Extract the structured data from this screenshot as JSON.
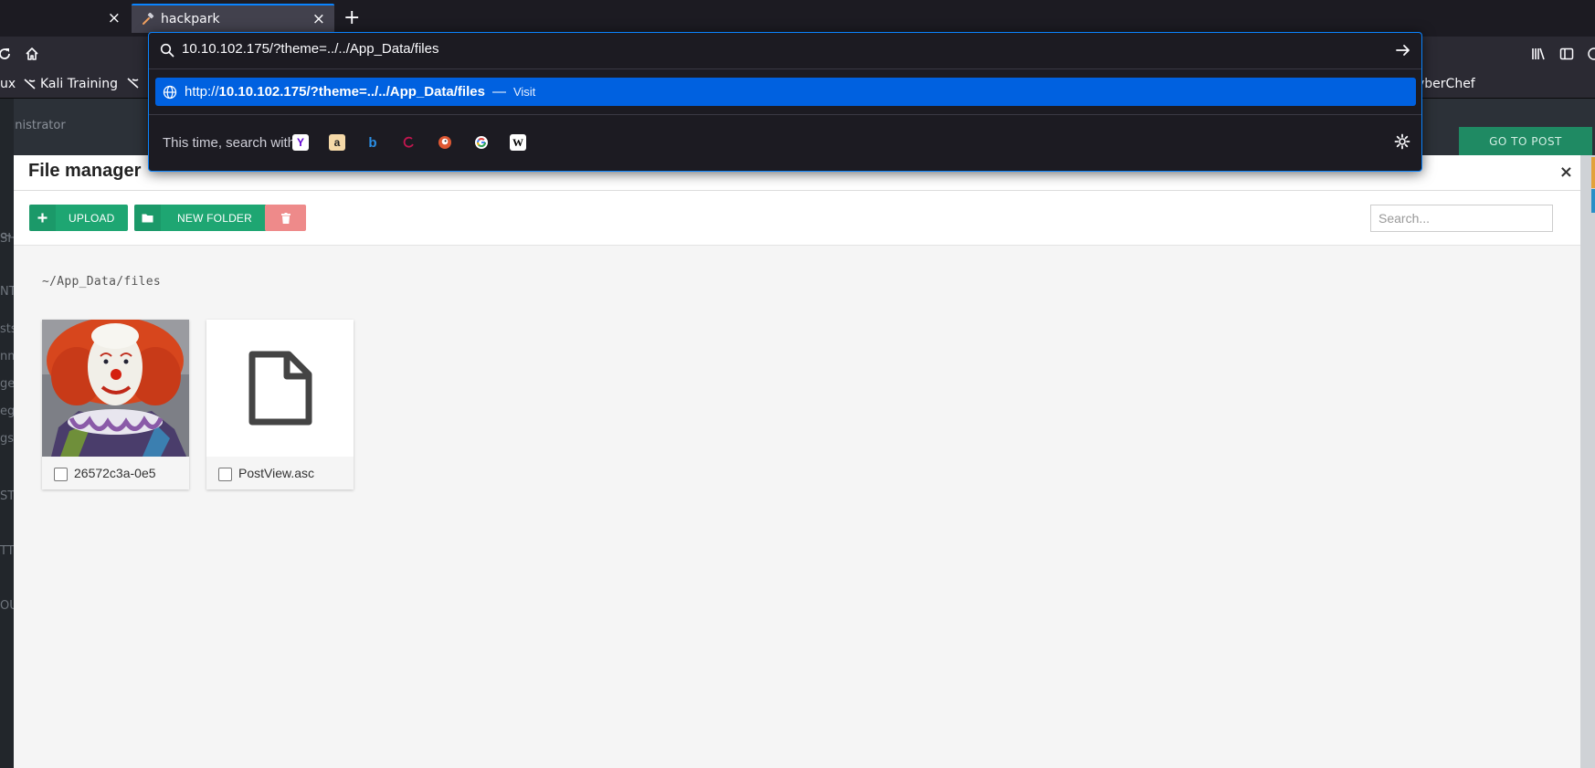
{
  "browser": {
    "tabs": [
      {
        "title": "",
        "active": false
      },
      {
        "title": "hackpark",
        "active": true
      }
    ],
    "close_glyph": "×",
    "new_tab_glyph": "+",
    "url": "10.10.102.175/?theme=../../App_Data/files",
    "bookmarks": {
      "left_fragment": "ux",
      "kali_training": "Kali Training",
      "right_fragment": "yberChef"
    },
    "suggestion": {
      "protocol": "http://",
      "host_path": "10.10.102.175/?theme=../../App_Data/files",
      "separator": "—",
      "action": "Visit"
    },
    "one_off_label": "This time, search with:",
    "search_engines": [
      "yahoo-icon",
      "amazon-icon",
      "bing-icon",
      "debian-icon",
      "duckduckgo-icon",
      "google-icon",
      "wikipedia-icon"
    ]
  },
  "page": {
    "admin_text": "ministrator",
    "goto_post": "GO TO POST",
    "sidebar_fragments": [
      "SH",
      "NT",
      "sts",
      "nm",
      "ges",
      "eg",
      "gs",
      "ST",
      "TT",
      "OU"
    ]
  },
  "file_manager": {
    "title": "File manager",
    "close": "×",
    "upload_label": "UPLOAD",
    "new_folder_label": "NEW FOLDER",
    "search_placeholder": "Search...",
    "path": "~/App_Data/files",
    "items": [
      {
        "name": "26572c3a-0e5",
        "kind": "image"
      },
      {
        "name": "PostView.asc",
        "kind": "file"
      }
    ]
  },
  "colors": {
    "accent_blue": "#0a84ff",
    "suggestion_bg": "#0061e0",
    "button_green": "#1ea672",
    "button_red": "#ee8a8a"
  }
}
